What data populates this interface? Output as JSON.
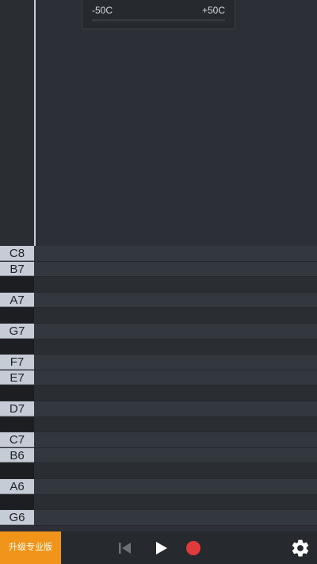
{
  "cents_scale": {
    "min_label": "-50C",
    "max_label": "+50C"
  },
  "notes": [
    {
      "label": "C8",
      "type": "white"
    },
    {
      "label": "B7",
      "type": "white"
    },
    {
      "label": "",
      "type": "black"
    },
    {
      "label": "A7",
      "type": "white"
    },
    {
      "label": "",
      "type": "black"
    },
    {
      "label": "G7",
      "type": "white"
    },
    {
      "label": "",
      "type": "black"
    },
    {
      "label": "F7",
      "type": "white"
    },
    {
      "label": "E7",
      "type": "white"
    },
    {
      "label": "",
      "type": "black"
    },
    {
      "label": "D7",
      "type": "white"
    },
    {
      "label": "",
      "type": "black"
    },
    {
      "label": "C7",
      "type": "white"
    },
    {
      "label": "B6",
      "type": "white"
    },
    {
      "label": "",
      "type": "black"
    },
    {
      "label": "A6",
      "type": "white"
    },
    {
      "label": "",
      "type": "black"
    },
    {
      "label": "G6",
      "type": "white"
    }
  ],
  "toolbar": {
    "upgrade_label": "升级专业版",
    "skip_back_icon": "skip-back-icon",
    "play_icon": "play-icon",
    "record_icon": "record-icon",
    "settings_icon": "gear-icon"
  },
  "colors": {
    "accent": "#f0951a",
    "record": "#e03a3a"
  }
}
